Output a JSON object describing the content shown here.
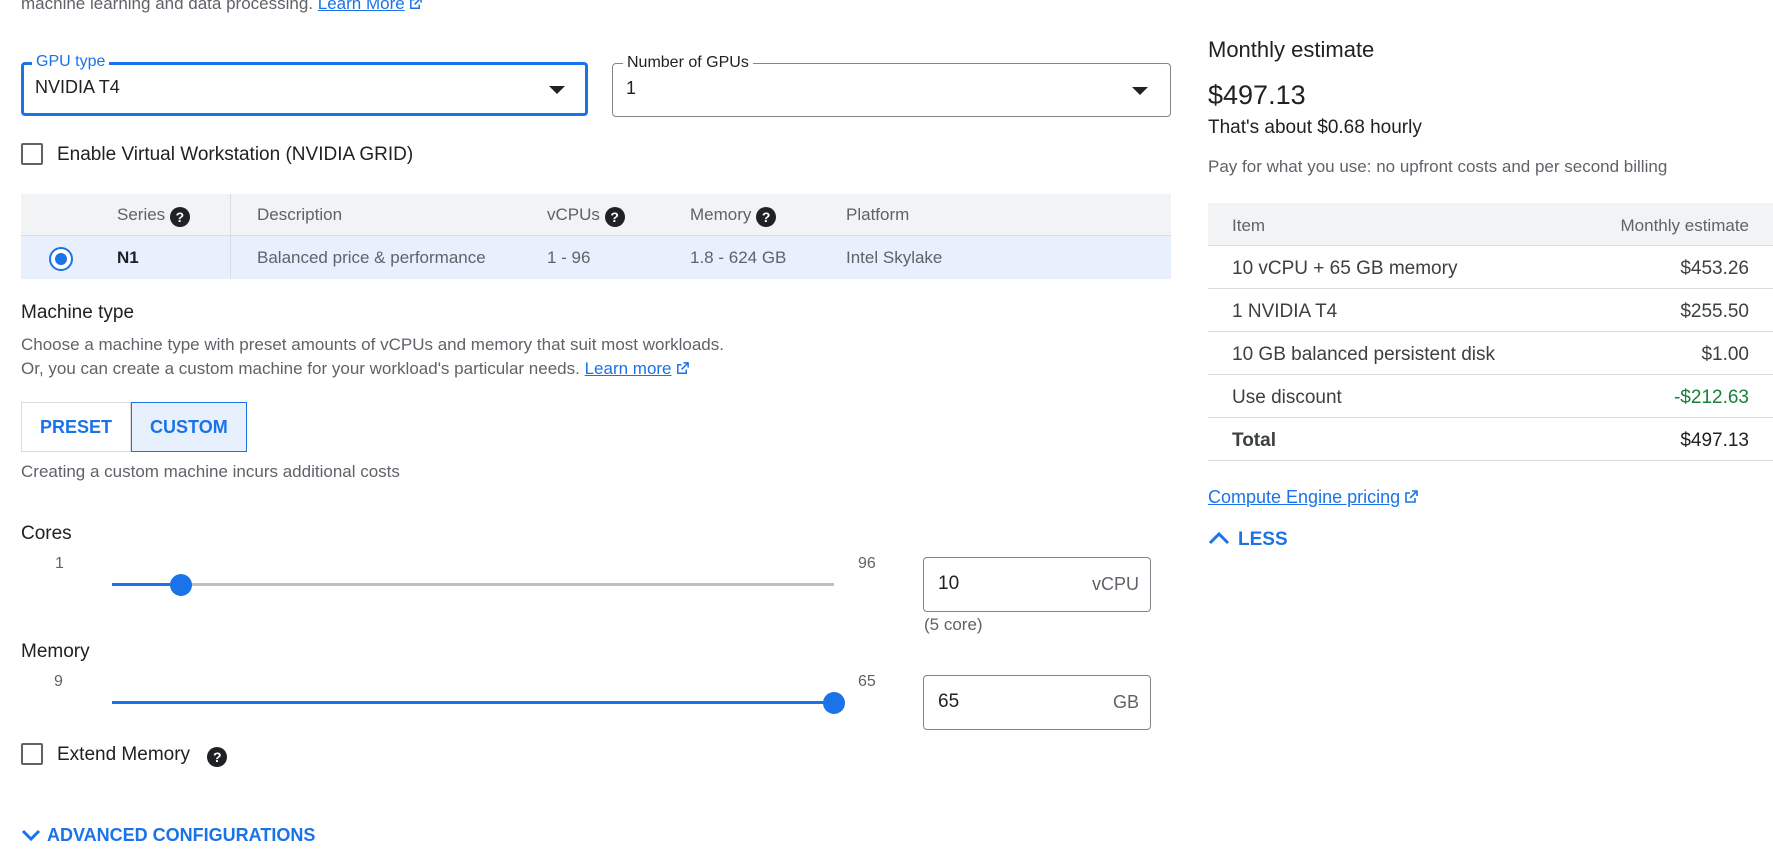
{
  "intro": {
    "text": "machine learning and data processing.",
    "link": "Learn More"
  },
  "gpu": {
    "type_label": "GPU type",
    "type_value": "NVIDIA T4",
    "count_label": "Number of GPUs",
    "count_value": "1"
  },
  "virtual_workstation": {
    "label": "Enable Virtual Workstation (NVIDIA GRID)",
    "checked": false
  },
  "series_table": {
    "headers": [
      "Series",
      "Description",
      "vCPUs",
      "Memory",
      "Platform"
    ],
    "rows": [
      {
        "series": "N1",
        "description": "Balanced price & performance",
        "vcpus": "1 - 96",
        "memory": "1.8 - 624 GB",
        "platform": "Intel Skylake",
        "selected": true
      }
    ]
  },
  "machine_type": {
    "title": "Machine type",
    "desc1": "Choose a machine type with preset amounts of vCPUs and memory that suit most workloads.",
    "desc2": "Or, you can create a custom machine for your workload's particular needs.",
    "learn_more": "Learn more",
    "preset_label": "PRESET",
    "custom_label": "CUSTOM",
    "selected": "CUSTOM",
    "custom_note": "Creating a custom machine incurs additional costs"
  },
  "cores": {
    "label": "Cores",
    "min": "1",
    "max": "96",
    "value": "10",
    "unit": "vCPU",
    "hint": "(5 core)",
    "fraction": 0.095
  },
  "memory": {
    "label": "Memory",
    "min": "9",
    "max": "65",
    "value": "65",
    "unit": "GB",
    "fraction": 1.0
  },
  "extend_memory": {
    "label": "Extend Memory",
    "checked": false
  },
  "advanced_label": "ADVANCED CONFIGURATIONS",
  "estimate": {
    "title": "Monthly estimate",
    "price": "$497.13",
    "hourly": "That's about $0.68 hourly",
    "note": "Pay for what you use: no upfront costs and per second billing",
    "headers": {
      "item": "Item",
      "cost": "Monthly estimate"
    },
    "rows": [
      {
        "item": "10 vCPU + 65 GB memory",
        "cost": "$453.26"
      },
      {
        "item": "1 NVIDIA T4",
        "cost": "$255.50"
      },
      {
        "item": "10 GB balanced persistent disk",
        "cost": "$1.00"
      },
      {
        "item": "Use discount",
        "cost": "-$212.63"
      },
      {
        "item": "Total",
        "cost": "$497.13"
      }
    ],
    "discount_color": "#188038",
    "pricing_link": "Compute Engine pricing",
    "less_label": "LESS"
  },
  "colors": {
    "accent": "#1a73e8",
    "selected_row": "#e8f0fe"
  },
  "icons": [
    "external-link-icon",
    "dropdown-arrow-icon",
    "help-icon",
    "chevron-up-icon",
    "chevron-down-icon"
  ]
}
